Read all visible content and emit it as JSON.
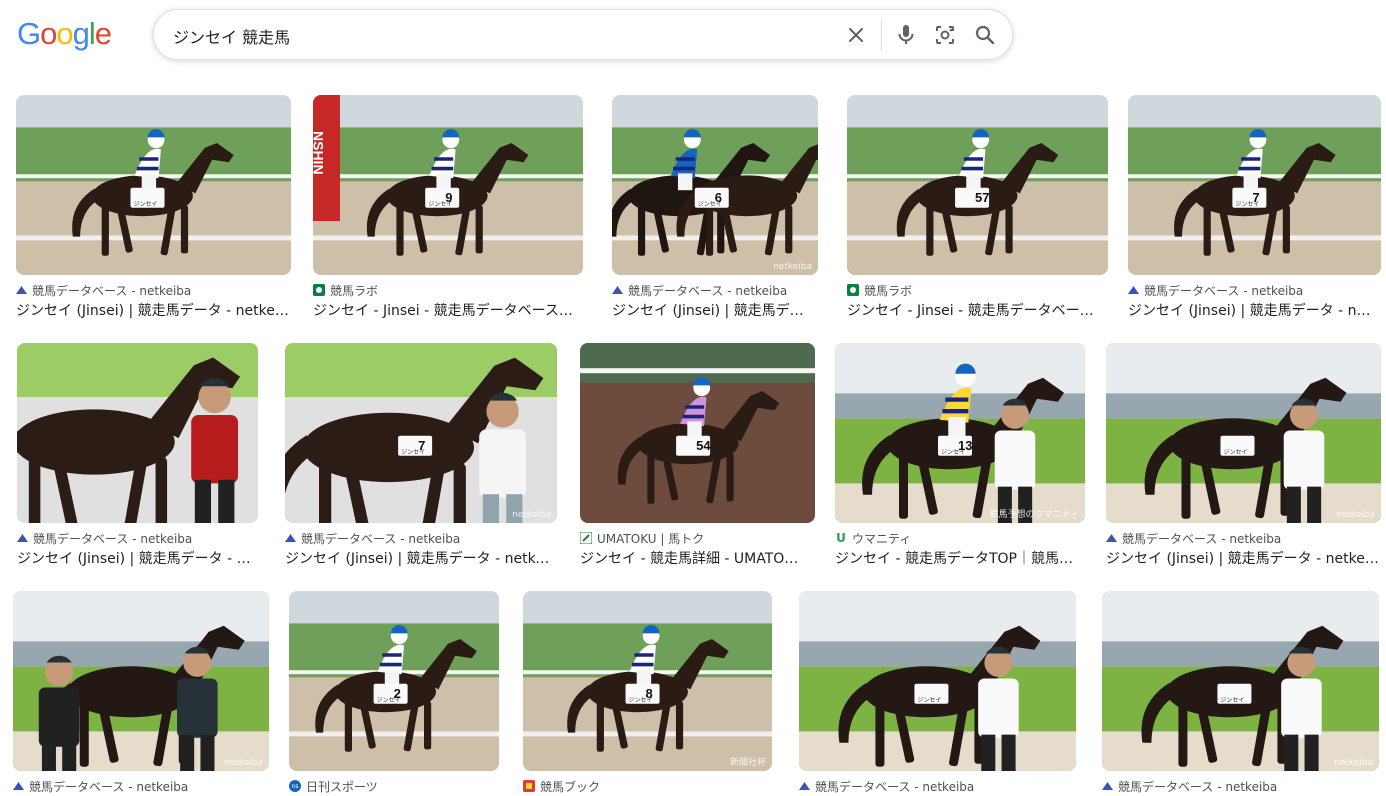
{
  "header": {
    "logo": [
      "G",
      "o",
      "o",
      "g",
      "l",
      "e"
    ],
    "logo_colors": [
      "#4285f4",
      "#ea4335",
      "#fbbc05",
      "#4285f4",
      "#34a853",
      "#ea4335"
    ],
    "query": "ジンセイ 競走馬"
  },
  "icons": {
    "clear": "close-icon",
    "voice": "microphone-icon",
    "lens": "camera-lens-icon",
    "search": "search-icon"
  },
  "results": [
    {
      "source": "競馬データベース - netkeiba",
      "favicon": "netkeiba",
      "title": "ジンセイ (Jinsei) | 競走馬データ - netkei…"
    },
    {
      "source": "競馬ラボ",
      "favicon": "lab",
      "title": "ジンセイ - Jinsei - 競走馬データベース…"
    },
    {
      "source": "競馬データベース - netkeiba",
      "favicon": "netkeiba",
      "title": "ジンセイ (Jinsei) | 競走馬デ…"
    },
    {
      "source": "競馬ラボ",
      "favicon": "lab",
      "title": "ジンセイ - Jinsei - 競走馬データベー…"
    },
    {
      "source": "競馬データベース - netkeiba",
      "favicon": "netkeiba",
      "title": "ジンセイ (Jinsei) | 競走馬データ - n…"
    },
    {
      "source": "競馬データベース - netkeiba",
      "favicon": "netkeiba",
      "title": "ジンセイ (Jinsei) | 競走馬データ - n…"
    },
    {
      "source": "競馬データベース - netkeiba",
      "favicon": "netkeiba",
      "title": "ジンセイ (Jinsei) | 競走馬データ - netke…"
    },
    {
      "source": "UMATOKU | 馬トク",
      "favicon": "umatoku",
      "title": "ジンセイ - 競走馬詳細 - UMATO…"
    },
    {
      "source": "ウマニティ",
      "favicon": "umanity",
      "title": "ジンセイ - 競走馬データTOP｜競馬…"
    },
    {
      "source": "競馬データベース - netkeiba",
      "favicon": "netkeiba",
      "title": "ジンセイ (Jinsei) | 競走馬データ - netke…"
    },
    {
      "source": "競馬データベース - netkeiba",
      "favicon": "netkeiba",
      "title": ""
    },
    {
      "source": "日刊スポーツ",
      "favicon": "nikkan",
      "title": ""
    },
    {
      "source": "競馬ブック",
      "favicon": "keibabook",
      "title": ""
    },
    {
      "source": "競馬データベース - netkeiba",
      "favicon": "netkeiba",
      "title": ""
    },
    {
      "source": "競馬データベース - netkeiba",
      "favicon": "netkeiba",
      "title": ""
    }
  ],
  "thumbnails": [
    {
      "scene": "horse-jockey-walk",
      "saddle": "ジンセイ",
      "number": ""
    },
    {
      "scene": "horse-race",
      "saddle": "ジンセイ",
      "number": "9",
      "overlay": "NSHIN"
    },
    {
      "scene": "horse-race-duo",
      "saddle": "ジンセイ",
      "number": "6",
      "watermark": "netkeiba"
    },
    {
      "scene": "horse-race",
      "saddle": "",
      "number": "57"
    },
    {
      "scene": "horse-race",
      "saddle": "ジンセイ",
      "number": "7"
    },
    {
      "scene": "horse-handler-closeup"
    },
    {
      "scene": "horse-trainer-portrait",
      "saddle": "ジンセイ",
      "number": "7",
      "watermark": "netkeiba"
    },
    {
      "scene": "horse-gallop-dirt",
      "number": "54"
    },
    {
      "scene": "horse-paddock-jockey",
      "saddle": "ジンセイ",
      "number": "13",
      "watermark": "競馬予想のウマニティ"
    },
    {
      "scene": "horse-paddock-lead",
      "saddle": "ジンセイ",
      "watermark": "netkeiba"
    },
    {
      "scene": "horse-winners-circle",
      "watermark": "netkeiba"
    },
    {
      "scene": "horse-gallop-grass",
      "saddle": "ジンセイ",
      "number": "2"
    },
    {
      "scene": "horse-race",
      "saddle": "ジンセイ",
      "number": "8",
      "watermark": "新聞社杯"
    },
    {
      "scene": "horse-paddock-lead",
      "saddle": "ジンセイ"
    },
    {
      "scene": "horse-paddock-lead",
      "saddle": "ジンセイ",
      "watermark": "netkeiba"
    }
  ]
}
